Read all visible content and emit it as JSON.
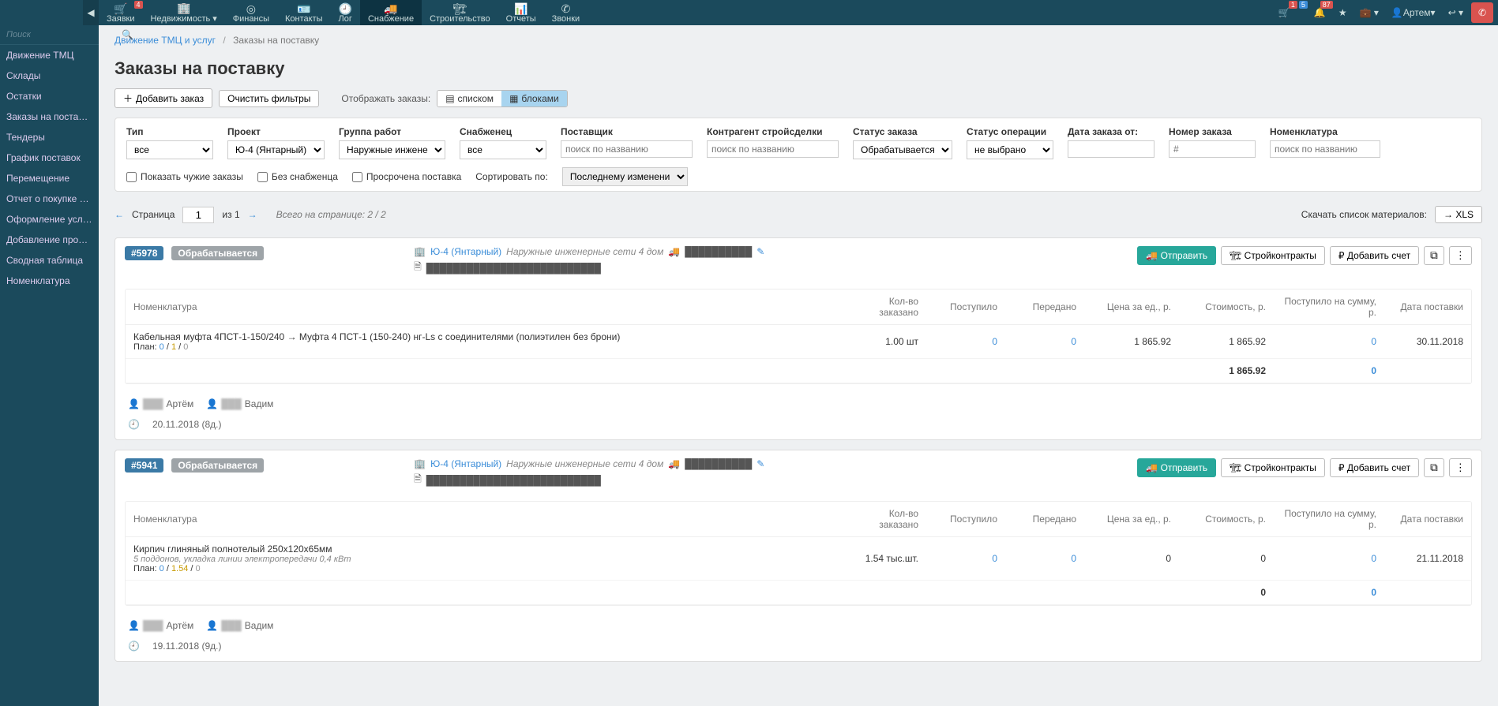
{
  "topnav": {
    "tabs": [
      {
        "icon": "cart",
        "label": "Заявки",
        "badge": "4"
      },
      {
        "icon": "building",
        "label": "Недвижимость",
        "caret": true
      },
      {
        "icon": "coin",
        "label": "Финансы"
      },
      {
        "icon": "id",
        "label": "Контакты"
      },
      {
        "icon": "clock",
        "label": "Лог"
      },
      {
        "icon": "truck",
        "label": "Снабжение"
      },
      {
        "icon": "crane",
        "label": "Строительство"
      },
      {
        "icon": "chart",
        "label": "Отчеты"
      },
      {
        "icon": "phone",
        "label": "Звонки"
      }
    ],
    "right": {
      "cartBadge1": "1",
      "cartBadge2": "5",
      "bellBadge": "87",
      "user": "Артем"
    }
  },
  "sidebar": {
    "searchPlaceholder": "Поиск",
    "items": [
      "Движение ТМЦ",
      "Склады",
      "Остатки",
      "Заказы на поставку",
      "Тендеры",
      "График поставок",
      "Перемещение",
      "Отчет о покупке Т…",
      "Оформление усл…",
      "Добавление пров…",
      "Сводная таблица",
      "Номенклатура"
    ]
  },
  "breadcrumb": {
    "a": "Движение ТМЦ и услуг",
    "b": "Заказы на поставку"
  },
  "pageTitle": "Заказы на поставку",
  "toolbar": {
    "add": "Добавить заказ",
    "clear": "Очистить фильтры",
    "showLabel": "Отображать заказы:",
    "viewList": "списком",
    "viewBlocks": "блоками"
  },
  "filters": {
    "labels": {
      "type": "Тип",
      "project": "Проект",
      "workGroup": "Группа работ",
      "supplier": "Снабженец",
      "vendor": "Поставщик",
      "dealContr": "Контрагент стройсделки",
      "orderStatus": "Статус заказа",
      "opStatus": "Статус операции",
      "dateFrom": "Дата заказа от:",
      "orderNo": "Номер заказа",
      "nomen": "Номенклатура"
    },
    "values": {
      "type": "все",
      "project": "Ю-4 (Янтарный)",
      "workGroup": "Наружные инжене",
      "supplier": "все",
      "orderStatus": "Обрабатывается",
      "opStatus": "не выбрано"
    },
    "ph": {
      "vendor": "поиск по названию",
      "dealContr": "поиск по названию",
      "orderNo": "#",
      "nomen": "поиск по названию"
    },
    "row2": {
      "showOthers": "Показать чужие заказы",
      "noSupplier": "Без снабженца",
      "overdue": "Просрочена поставка",
      "sortLabel": "Сортировать по:",
      "sortVal": "Последнему изменени"
    }
  },
  "pagerow": {
    "pageLabel": "Страница",
    "page": "1",
    "ofLabel": "из",
    "of": "1",
    "totals": "Всего на странице: 2 / 2",
    "download": "Скачать список материалов:",
    "xls": "→ XLS"
  },
  "columns": {
    "nomen": "Номенклатура",
    "qty": "Кол-во заказано",
    "in": "Поступило",
    "trans": "Передано",
    "price": "Цена за ед., р.",
    "cost": "Стоимость, р.",
    "sumIn": "Поступило на сумму, р.",
    "date": "Дата поставки"
  },
  "cardActions": {
    "send": "Отправить",
    "constr": "Стройконтракты",
    "addBill": "Добавить счет"
  },
  "footLabels": {
    "planPrefix": "План:"
  },
  "orders": [
    {
      "id": "#5978",
      "status": "Обрабатывается",
      "project": "Ю-4 (Янтарный)",
      "projectNote": "Наружные инженерные сети 4 дом",
      "rows": [
        {
          "name": "Кабельная муфта 4ПСТ-1-150/240  →  Муфта 4 ПСТ-1 (150-240) нг-Ls с соединителями (полиэтилен без брони)",
          "plan": [
            "0",
            "1",
            "0"
          ],
          "qty": "1.00 шт",
          "in": "0",
          "trans": "0",
          "price": "1 865.92",
          "cost": "1 865.92",
          "sumIn": "0",
          "date": "30.11.2018"
        }
      ],
      "totals": {
        "cost": "1 865.92",
        "sumIn": "0"
      },
      "foot": {
        "p1": "Артём",
        "p2": "Вадим",
        "time": "20.11.2018 (8д.)"
      }
    },
    {
      "id": "#5941",
      "status": "Обрабатывается",
      "project": "Ю-4 (Янтарный)",
      "projectNote": "Наружные инженерные сети 4 дом",
      "rows": [
        {
          "name": "Кирпич глиняный полнотелый 250х120х65мм",
          "sub": "5 поддонов, укладка линии электропередачи 0,4 кВт",
          "plan": [
            "0",
            "1.54",
            "0"
          ],
          "qty": "1.54 тыс.шт.",
          "in": "0",
          "trans": "0",
          "price": "0",
          "cost": "0",
          "sumIn": "0",
          "date": "21.11.2018"
        }
      ],
      "totals": {
        "cost": "0",
        "sumIn": "0"
      },
      "foot": {
        "p1": "Артём",
        "p2": "Вадим",
        "time": "19.11.2018 (9д.)"
      }
    }
  ]
}
